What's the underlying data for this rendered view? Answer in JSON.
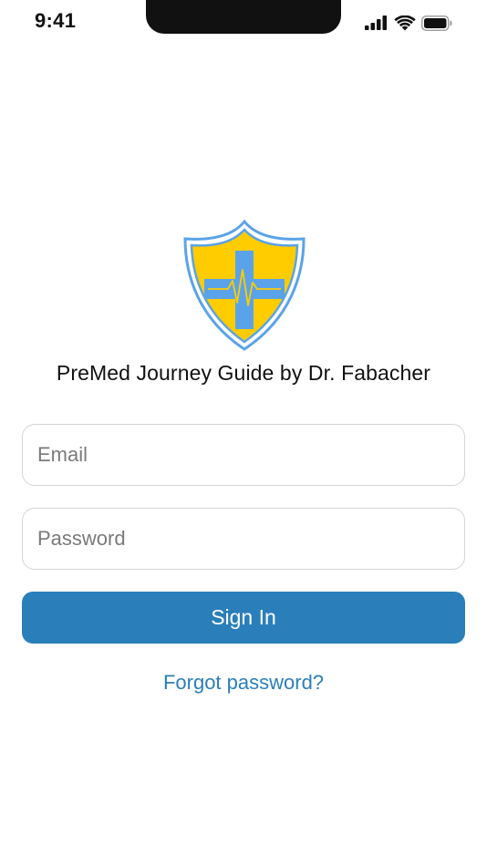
{
  "status_bar": {
    "time": "9:41",
    "icons": [
      "cellular-signal-icon",
      "wifi-icon",
      "battery-icon"
    ]
  },
  "logo": {
    "icon": "medical-shield-icon",
    "colors": {
      "shield_fill": "#ffcc00",
      "shield_outline": "#5aa3e8",
      "cross": "#5aa3e8"
    }
  },
  "app": {
    "title": "PreMed Journey Guide by Dr. Fabacher"
  },
  "form": {
    "email": {
      "value": "",
      "placeholder": "Email"
    },
    "password": {
      "value": "",
      "placeholder": "Password"
    },
    "sign_in_label": "Sign In",
    "forgot_label": "Forgot password?"
  },
  "colors": {
    "accent": "#2a7fba",
    "background": "#ffffff"
  }
}
